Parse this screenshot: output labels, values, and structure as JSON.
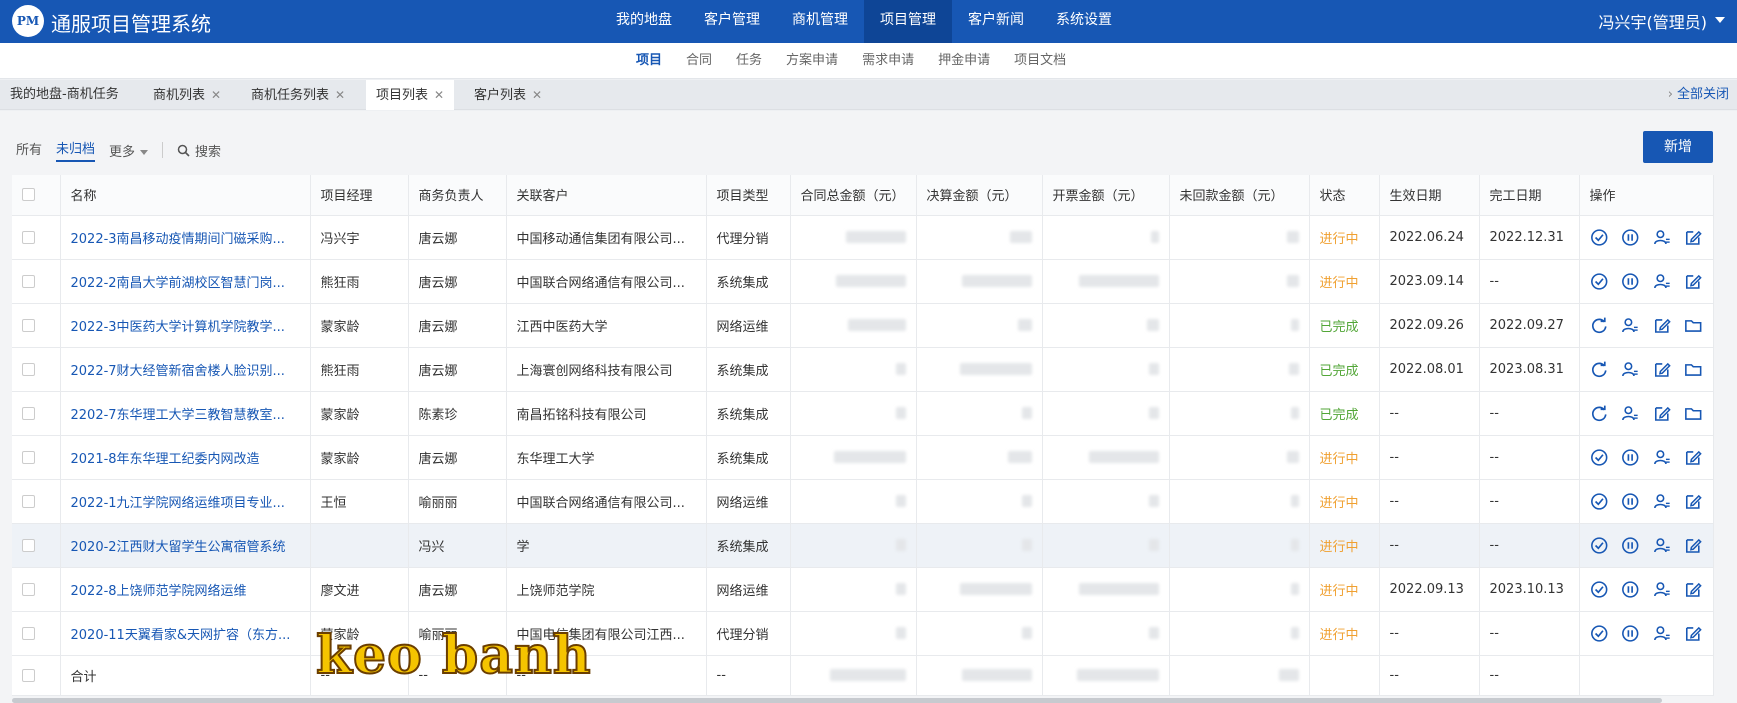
{
  "header": {
    "logo_text": "PM",
    "app_title": "通服项目管理系统",
    "nav": [
      "我的地盘",
      "客户管理",
      "商机管理",
      "项目管理",
      "客户新闻",
      "系统设置"
    ],
    "active_nav_index": 3,
    "user": "冯兴宇(管理员)"
  },
  "subnav": {
    "items": [
      "项目",
      "合同",
      "任务",
      "方案申请",
      "需求申请",
      "押金申请",
      "项目文档"
    ],
    "active_index": 0
  },
  "tabs": {
    "items": [
      {
        "label": "我的地盘-商机任务",
        "closable": false
      },
      {
        "label": "商机列表",
        "closable": true
      },
      {
        "label": "商机任务列表",
        "closable": true
      },
      {
        "label": "项目列表",
        "closable": true
      },
      {
        "label": "客户列表",
        "closable": true
      }
    ],
    "active_index": 3,
    "close_all": "全部关闭"
  },
  "filters": {
    "all": "所有",
    "unarchived": "未归档",
    "more": "更多",
    "search": "搜索"
  },
  "new_button": "新增",
  "table": {
    "columns": [
      "名称",
      "项目经理",
      "商务负责人",
      "关联客户",
      "项目类型",
      "合同总金额（元）",
      "决算金额（元）",
      "开票金额（元）",
      "未回款金额（元）",
      "状态",
      "生效日期",
      "完工日期",
      "操作"
    ],
    "rows": [
      {
        "name": "2022-3南昌移动疫情期间门磁采购...",
        "manager": "冯兴宇",
        "business": "唐云娜",
        "customer": "中国移动通信集团有限公司...",
        "type": "代理分销",
        "status": "进行中",
        "start": "2022.06.24",
        "end": "2022.12.31"
      },
      {
        "name": "2022-2南昌大学前湖校区智慧门岗...",
        "manager": "熊狂雨",
        "business": "唐云娜",
        "customer": "中国联合网络通信有限公司...",
        "type": "系统集成",
        "status": "进行中",
        "start": "2023.09.14",
        "end": "--"
      },
      {
        "name": "2022-3中医药大学计算机学院教学...",
        "manager": "蒙家龄",
        "business": "唐云娜",
        "customer": "江西中医药大学",
        "type": "网络运维",
        "status": "已完成",
        "start": "2022.09.26",
        "end": "2022.09.27"
      },
      {
        "name": "2022-7财大经管新宿舍楼人脸识别...",
        "manager": "熊狂雨",
        "business": "唐云娜",
        "customer": "上海寰创网络科技有限公司",
        "type": "系统集成",
        "status": "已完成",
        "start": "2022.08.01",
        "end": "2023.08.31"
      },
      {
        "name": "2202-7东华理工大学三教智慧教室...",
        "manager": "蒙家龄",
        "business": "陈素珍",
        "customer": "南昌拓铭科技有限公司",
        "type": "系统集成",
        "status": "已完成",
        "start": "--",
        "end": "--"
      },
      {
        "name": "2021-8年东华理工纪委内网改造",
        "manager": "蒙家龄",
        "business": "唐云娜",
        "customer": "东华理工大学",
        "type": "系统集成",
        "status": "进行中",
        "start": "--",
        "end": "--"
      },
      {
        "name": "2022-1九江学院网络运维项目专业...",
        "manager": "王恒",
        "business": "喻丽丽",
        "customer": "中国联合网络通信有限公司...",
        "type": "网络运维",
        "status": "进行中",
        "start": "--",
        "end": "--"
      },
      {
        "name": "2020-2江西财大留学生公寓宿管系统",
        "manager": "",
        "business": "冯兴",
        "customer": "学",
        "type": "系统集成",
        "status": "进行中",
        "start": "--",
        "end": "--"
      },
      {
        "name": "2022-8上饶师范学院网络运维",
        "manager": "廖文进",
        "business": "唐云娜",
        "customer": "上饶师范学院",
        "type": "网络运维",
        "status": "进行中",
        "start": "2022.09.13",
        "end": "2023.10.13"
      },
      {
        "name": "2020-11天翼看家&天网扩容（东方...",
        "manager": "蒙家龄",
        "business": "喻丽丽",
        "customer": "中国电信集团有限公司江西...",
        "type": "代理分销",
        "status": "进行中",
        "start": "--",
        "end": "--"
      }
    ],
    "total": {
      "label": "合计",
      "manager": "--",
      "business": "--",
      "customer": "--",
      "type": "--",
      "start": "--",
      "end": "--"
    }
  },
  "watermark": "keo banh",
  "colors": {
    "brand": "#1757b4",
    "in_progress": "#f0a030",
    "done": "#52a637"
  }
}
